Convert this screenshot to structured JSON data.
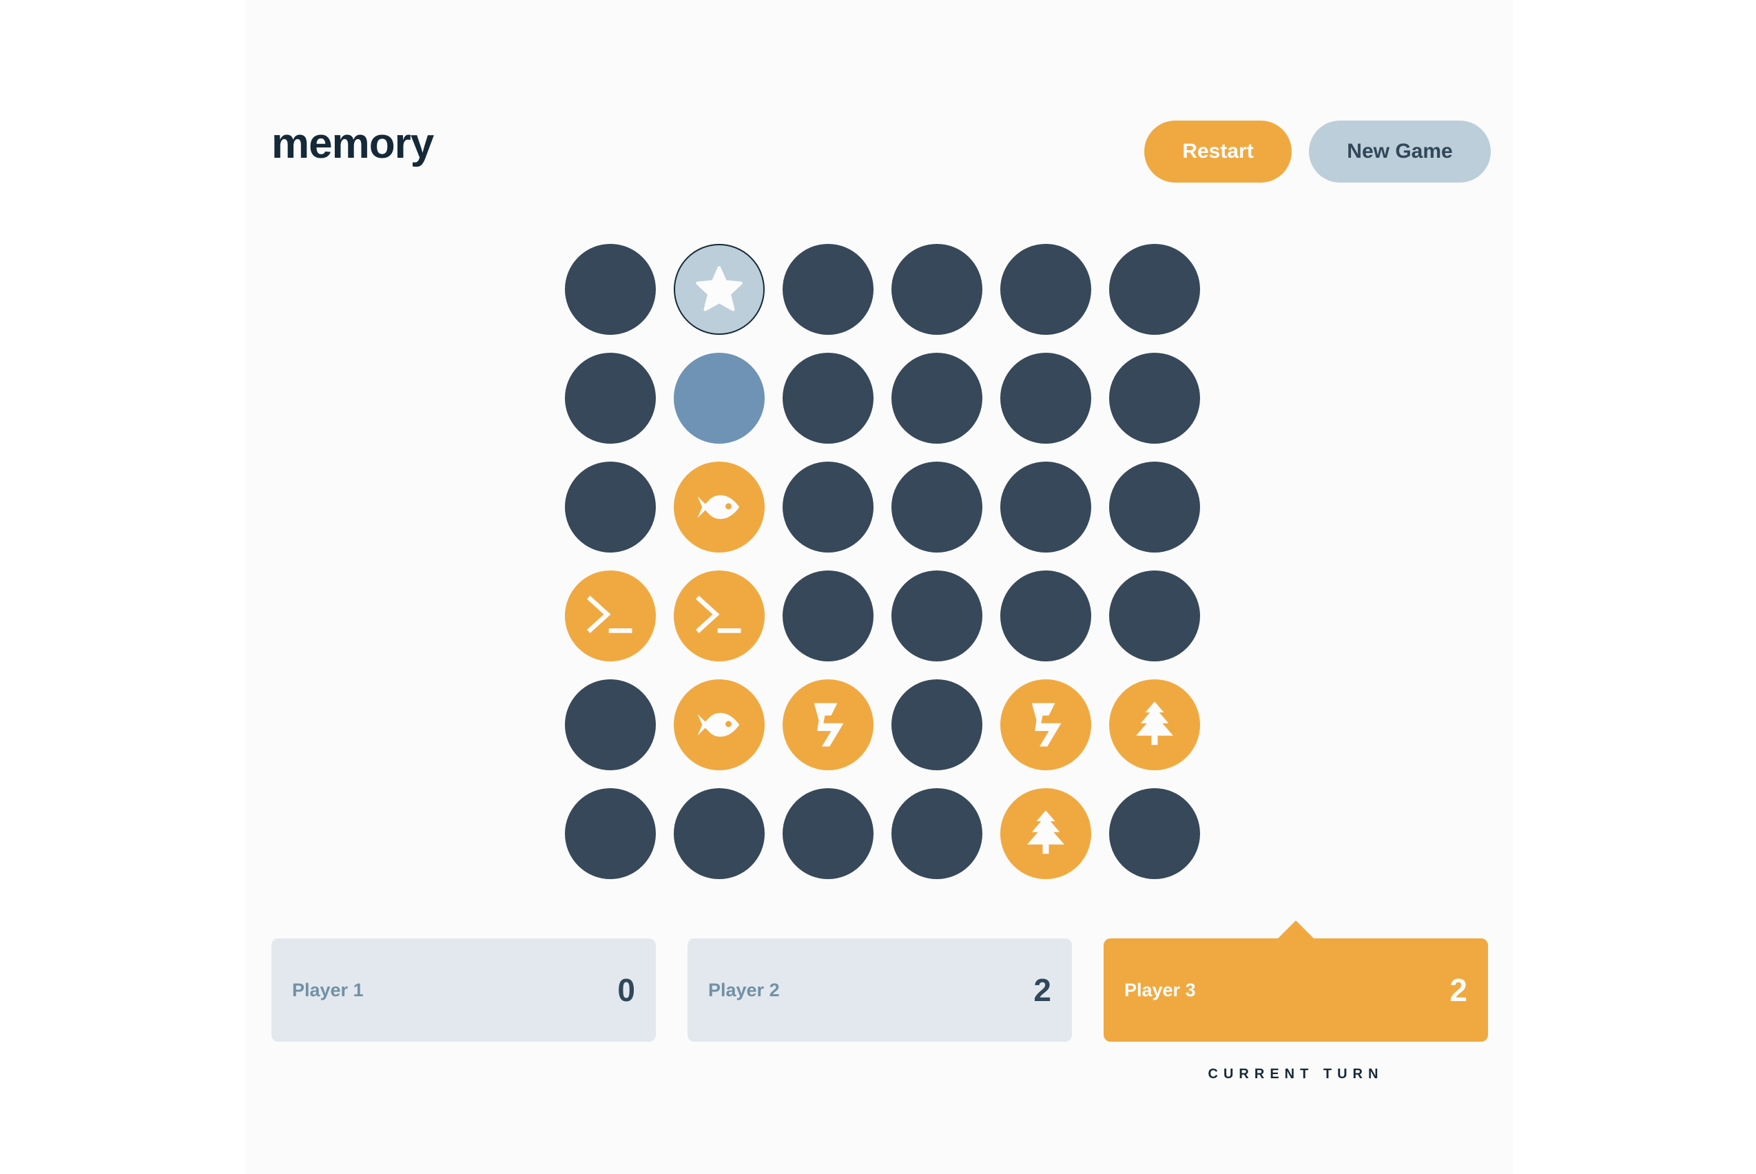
{
  "header": {
    "logo": "memory",
    "restart_label": "Restart",
    "new_game_label": "New Game"
  },
  "board": {
    "size": 6,
    "tiles": [
      {
        "state": "hidden",
        "icon": null
      },
      {
        "state": "revealed",
        "icon": "star-icon"
      },
      {
        "state": "hidden",
        "icon": null
      },
      {
        "state": "hidden",
        "icon": null
      },
      {
        "state": "hidden",
        "icon": null
      },
      {
        "state": "hidden",
        "icon": null
      },
      {
        "state": "hidden",
        "icon": null
      },
      {
        "state": "hover",
        "icon": null
      },
      {
        "state": "hidden",
        "icon": null
      },
      {
        "state": "hidden",
        "icon": null
      },
      {
        "state": "hidden",
        "icon": null
      },
      {
        "state": "hidden",
        "icon": null
      },
      {
        "state": "hidden",
        "icon": null
      },
      {
        "state": "matched",
        "icon": "fish-icon"
      },
      {
        "state": "hidden",
        "icon": null
      },
      {
        "state": "hidden",
        "icon": null
      },
      {
        "state": "hidden",
        "icon": null
      },
      {
        "state": "hidden",
        "icon": null
      },
      {
        "state": "matched",
        "icon": "terminal-icon"
      },
      {
        "state": "matched",
        "icon": "terminal-icon"
      },
      {
        "state": "hidden",
        "icon": null
      },
      {
        "state": "hidden",
        "icon": null
      },
      {
        "state": "hidden",
        "icon": null
      },
      {
        "state": "hidden",
        "icon": null
      },
      {
        "state": "hidden",
        "icon": null
      },
      {
        "state": "matched",
        "icon": "fish-icon"
      },
      {
        "state": "matched",
        "icon": "lightning-icon"
      },
      {
        "state": "hidden",
        "icon": null
      },
      {
        "state": "matched",
        "icon": "lightning-icon"
      },
      {
        "state": "matched",
        "icon": "tree-icon"
      },
      {
        "state": "hidden",
        "icon": null
      },
      {
        "state": "hidden",
        "icon": null
      },
      {
        "state": "hidden",
        "icon": null
      },
      {
        "state": "hidden",
        "icon": null
      },
      {
        "state": "matched",
        "icon": "tree-icon"
      },
      {
        "state": "hidden",
        "icon": null
      }
    ]
  },
  "players": [
    {
      "name": "Player 1",
      "score": "0",
      "active": false
    },
    {
      "name": "Player 2",
      "score": "2",
      "active": false
    },
    {
      "name": "Player 3",
      "score": "2",
      "active": true
    }
  ],
  "turn_label": "CURRENT TURN",
  "colors": {
    "accent": "#f0a940",
    "tile_hidden": "#364859",
    "tile_revealed": "#bcced9",
    "tile_hover": "#6e93b4",
    "text_dark": "#152938"
  }
}
